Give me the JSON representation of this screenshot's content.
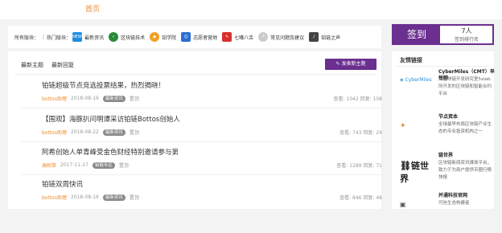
{
  "nav": {
    "home": "首页"
  },
  "categories": {
    "label": "所有版块：",
    "hot_label": "热门版块：",
    "items": [
      {
        "name": "最新资讯",
        "icon": "news-icon",
        "color": "#1e8fe0",
        "badge": "NEWS"
      },
      {
        "name": "区块链技术",
        "icon": "blockchain-icon",
        "color": "#2a8a3a",
        "badge": ""
      },
      {
        "name": "铂学院",
        "icon": "academy-icon",
        "color": "#f0a020",
        "badge": ""
      },
      {
        "name": "志愿者营地",
        "icon": "volunteer-icon",
        "color": "#2a6fd0",
        "badge": ""
      },
      {
        "name": "七嘴八舌",
        "icon": "chat-icon",
        "color": "#d9302c",
        "badge": ""
      },
      {
        "name": "常见问题及建议",
        "icon": "faq-icon",
        "color": "#bbbbbb",
        "badge": ""
      },
      {
        "name": "铂链之声",
        "icon": "voice-icon",
        "color": "#444444",
        "badge": ""
      }
    ]
  },
  "signin": {
    "button": "签到",
    "count": "7人",
    "rank": "签到排行名"
  },
  "tabs": {
    "latest_topics": "最新主题",
    "latest_replies": "最新回复"
  },
  "new_topic_button": "发表新主题",
  "topics": [
    {
      "title": "铂链超级节点竞选投票结果，热烈揭晓！",
      "author": "bottos助理",
      "date": "2018-08-16",
      "tag": "最新资讯",
      "extra": "置顶",
      "views": "查看: 1042",
      "replies": "回复: 108"
    },
    {
      "title": "【围观】海豚扒问明谭采访铂链Bottos创始人",
      "author": "bottos助理",
      "date": "2018-08-22",
      "tag": "最新资讯",
      "extra": "置顶",
      "views": "查看: 743",
      "replies": "回复: 29"
    },
    {
      "title": "阿希创始人单青峰受金色财经特别邀请参与第",
      "author": "澜树草",
      "date": "2017-11-27",
      "tag": "铂链专区",
      "extra": "置顶",
      "views": "查看: 1289",
      "replies": "回复: 71"
    },
    {
      "title": "铂链双周快讯",
      "author": "bottos助理",
      "date": "2018-08-16",
      "tag": "最新资讯",
      "extra": "置顶",
      "views": "查看: 846",
      "replies": "回复: 48"
    }
  ],
  "friends": {
    "header": "友情链接",
    "items": [
      {
        "logo_text": "CyberMiles",
        "logo_color": "#2a8fd6",
        "name": "CyberMiles（CMT）早每聊",
        "desc": "由区块链开发研究室5xlab 所开发的区块链和智能合约平台"
      },
      {
        "logo_text": "",
        "logo_color": "#e08a2a",
        "name": "节点资本",
        "desc": "全球最早布局区块链产业生态的专业投资机构之一"
      },
      {
        "logo_text": "链世界",
        "logo_color": "#222222",
        "name": "链世界",
        "desc": "区块链新闻资讯媒体平台，致力于为用户提供币圈行情快报"
      },
      {
        "logo_text": "",
        "logo_color": "#555555",
        "name": "并通科技官网",
        "desc": "可信生态构建者"
      }
    ]
  }
}
